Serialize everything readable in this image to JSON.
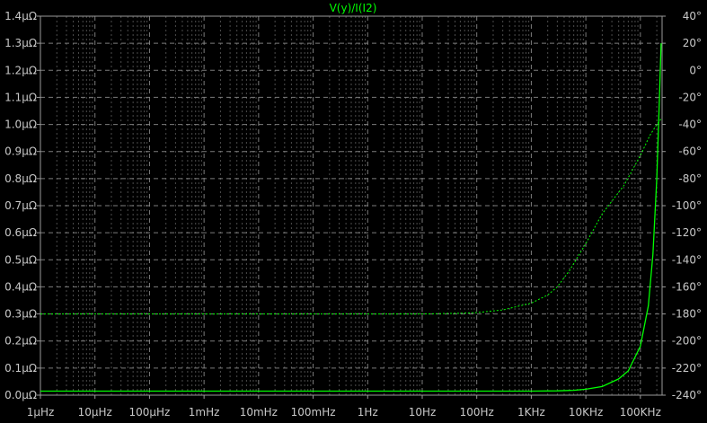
{
  "chart_data": {
    "type": "line",
    "title": "V(y)/I(I2)",
    "x_scale": "log",
    "x_ticks": [
      "1µHz",
      "10µHz",
      "100µHz",
      "1mHz",
      "10mHz",
      "100mHz",
      "1Hz",
      "10Hz",
      "100Hz",
      "1KHz",
      "10KHz",
      "100KHz"
    ],
    "x_tick_values_hz": [
      1e-06,
      1e-05,
      0.0001,
      0.001,
      0.01,
      0.1,
      1,
      10,
      100,
      1000,
      10000,
      100000
    ],
    "xlim_hz": [
      1e-06,
      250000
    ],
    "y_left_ticks": [
      "0.0µΩ",
      "0.1µΩ",
      "0.2µΩ",
      "0.3µΩ",
      "0.4µΩ",
      "0.5µΩ",
      "0.6µΩ",
      "0.7µΩ",
      "0.8µΩ",
      "0.9µΩ",
      "1.0µΩ",
      "1.1µΩ",
      "1.2µΩ",
      "1.3µΩ",
      "1.4µΩ"
    ],
    "y_left_values": [
      0.0,
      0.1,
      0.2,
      0.3,
      0.4,
      0.5,
      0.6,
      0.7,
      0.8,
      0.9,
      1.0,
      1.1,
      1.2,
      1.3,
      1.4
    ],
    "ylim_left": [
      0.0,
      1.4
    ],
    "y_right_ticks": [
      "-240°",
      "-220°",
      "-200°",
      "-180°",
      "-160°",
      "-140°",
      "-120°",
      "-100°",
      "-80°",
      "-60°",
      "-40°",
      "-20°",
      "0°",
      "20°",
      "40°"
    ],
    "y_right_values": [
      -240,
      -220,
      -200,
      -180,
      -160,
      -140,
      -120,
      -100,
      -80,
      -60,
      -40,
      -20,
      0,
      20,
      40
    ],
    "ylim_right": [
      -240,
      40
    ],
    "grid": true,
    "series": [
      {
        "axis": "left",
        "style": "solid",
        "x_hz": [
          1e-06,
          1000,
          3000,
          6000,
          10000,
          20000,
          40000,
          60000,
          100000,
          140000,
          170000,
          200000,
          220000,
          240000
        ],
        "y": [
          0.015,
          0.015,
          0.016,
          0.018,
          0.022,
          0.032,
          0.06,
          0.09,
          0.18,
          0.33,
          0.52,
          0.8,
          1.05,
          1.3
        ]
      },
      {
        "axis": "right",
        "style": "dashed",
        "x_hz": [
          1e-06,
          10,
          50,
          100,
          300,
          1000,
          2000,
          3000,
          5000,
          10000,
          20000,
          50000,
          100000,
          150000,
          200000,
          240000
        ],
        "y": [
          -180,
          -180,
          -179.5,
          -179,
          -177,
          -172,
          -166,
          -160,
          -148,
          -128,
          -106,
          -85,
          -63,
          -48,
          -40,
          -36
        ]
      }
    ]
  },
  "colors": {
    "background": "#000000",
    "trace": "#00ff00",
    "grid": "#8a8a8a",
    "axis_frame": "#9a9a9a",
    "tick_text": "#c8c8c8"
  }
}
